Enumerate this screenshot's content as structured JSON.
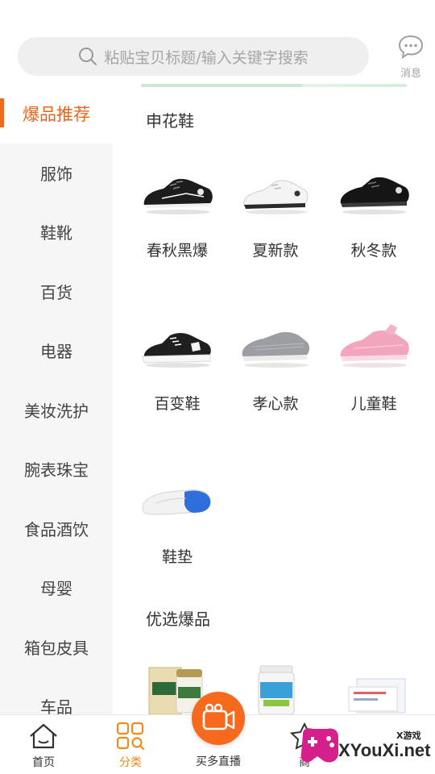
{
  "header": {
    "search_placeholder": "粘贴宝贝标题/输入关键字搜索",
    "message_label": "消息"
  },
  "sidebar": {
    "items": [
      {
        "label": "爆品推荐",
        "active": true
      },
      {
        "label": "服饰"
      },
      {
        "label": "鞋靴"
      },
      {
        "label": "百货"
      },
      {
        "label": "电器"
      },
      {
        "label": "美妆洗护"
      },
      {
        "label": "腕表珠宝"
      },
      {
        "label": "食品酒饮"
      },
      {
        "label": "母婴"
      },
      {
        "label": "箱包皮具"
      },
      {
        "label": "车品"
      }
    ]
  },
  "main": {
    "section1_title": "申花鞋",
    "items": [
      {
        "label": "春秋黑爆",
        "icon": "black-sneaker-icon"
      },
      {
        "label": "夏新款",
        "icon": "white-sneaker-icon"
      },
      {
        "label": "秋冬款",
        "icon": "black-leather-shoe-icon"
      },
      {
        "label": "百变鞋",
        "icon": "black-canvas-shoe-icon"
      },
      {
        "label": "孝心款",
        "icon": "grey-mesh-shoe-icon"
      },
      {
        "label": "儿童鞋",
        "icon": "pink-sneaker-icon"
      },
      {
        "label": "鞋垫",
        "icon": "insole-icon"
      }
    ],
    "section2_title": "优选爆品"
  },
  "tabbar": {
    "tabs": [
      {
        "label": "首页",
        "icon": "home-icon"
      },
      {
        "label": "分类",
        "icon": "category-icon",
        "active": true
      },
      {
        "label": "买多直播",
        "icon": "video-camera-icon"
      },
      {
        "label": "商",
        "icon": "star-icon"
      }
    ]
  },
  "watermark": {
    "text": "XYouXi.net",
    "small": "X游戏"
  },
  "colors": {
    "accent": "#f06a1e",
    "tab_active": "#f08a1c",
    "sidebar_bg": "#f6f6f6"
  }
}
